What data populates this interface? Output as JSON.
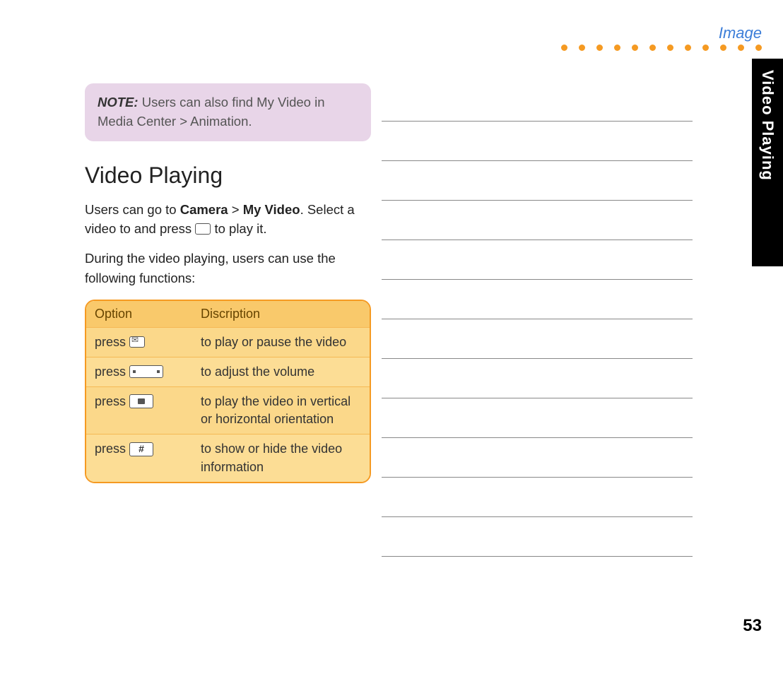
{
  "header": {
    "label": "Image",
    "dot_count": 12
  },
  "side_tab": {
    "text": "Video Playing"
  },
  "page_number": "53",
  "note": {
    "label": "NOTE:",
    "text": "Users can also find My Video in Media Center > Animation."
  },
  "section": {
    "title": "Video Playing",
    "intro_prefix": "Users can go to ",
    "intro_bold1": "Camera",
    "intro_gt": " > ",
    "intro_bold2": "My Video",
    "intro_mid": ". Select a video to and press ",
    "intro_suffix": " to play it.",
    "para2": "During the video playing, users can use the following functions:"
  },
  "table": {
    "headers": {
      "col1": "Option",
      "col2": "Discription"
    },
    "rows": [
      {
        "option_prefix": "press ",
        "icon": "envelope",
        "description": "to play or pause the video"
      },
      {
        "option_prefix": "press ",
        "icon": "volume",
        "description": "to adjust the volume"
      },
      {
        "option_prefix": "press ",
        "icon": "camera",
        "description": "to play the video in vertical or horizontal orientation"
      },
      {
        "option_prefix": "press ",
        "icon": "hash",
        "icon_text": "#",
        "description": "to show or hide the video information"
      }
    ]
  },
  "right_lines_count": 12
}
